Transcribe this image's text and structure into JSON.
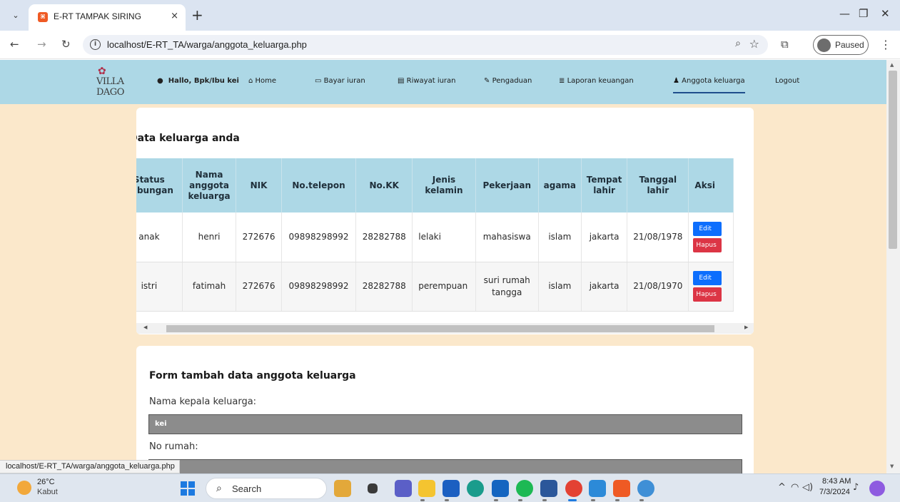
{
  "browser": {
    "tab_title": "E-RT TAMPAK SIRING",
    "tab_close": "×",
    "new_tab": "+",
    "url": "localhost/E-RT_TA/warga/anggota_keluarga.php",
    "profile_status": "Paused",
    "status_url": "localhost/E-RT_TA/warga/anggota_keluarga.php"
  },
  "site": {
    "logo_text": "VILLA DAGO",
    "greeting": "Hallo, Bpk/Ibu kei",
    "nav": [
      {
        "icon": "home-icon",
        "label": "Home"
      },
      {
        "icon": "card-icon",
        "label": "Bayar iuran"
      },
      {
        "icon": "history-icon",
        "label": "Riwayat iuran"
      },
      {
        "icon": "pen-icon",
        "label": "Pengaduan"
      },
      {
        "icon": "database-icon",
        "label": "Laporan keuangan"
      },
      {
        "icon": "users-icon",
        "label": "Anggota keluarga"
      },
      {
        "icon": "",
        "label": "Logout"
      }
    ],
    "active_nav": "Anggota keluarga",
    "accent_color": "#add8e6",
    "page_bg": "#fbe8cb"
  },
  "family_table": {
    "title": "Data keluarga anda",
    "headers": [
      "Status hubungan",
      "Nama anggota keluarga",
      "NIK",
      "No.telepon",
      "No.KK",
      "Jenis kelamin",
      "Pekerjaan",
      "agama",
      "Tempat lahir",
      "Tanggal lahir",
      "Aksi"
    ],
    "rows": [
      {
        "status": "anak",
        "nama": "henri",
        "nik": "272676",
        "telepon": "09898298992",
        "kk": "28282788",
        "jk": "lelaki",
        "pekerjaan": "mahasiswa",
        "agama": "islam",
        "tempat": "jakarta",
        "tanggal": "21/08/1978",
        "edit": "Edit",
        "hapus": "Hapus"
      },
      {
        "status": "istri",
        "nama": "fatimah",
        "nik": "272676",
        "telepon": "09898298992",
        "kk": "28282788",
        "jk": "perempuan",
        "pekerjaan": "suri rumah tangga",
        "agama": "islam",
        "tempat": "jakarta",
        "tanggal": "21/08/1970",
        "edit": "Edit",
        "hapus": "Hapus"
      }
    ]
  },
  "form": {
    "title": "Form tambah data anggota keluarga",
    "kepala_label": "Nama kepala keluarga:",
    "kepala_value": "kei",
    "rumah_label": "No rumah:",
    "rumah_value": ""
  },
  "taskbar": {
    "temperature": "26°C",
    "weather": "Kabut",
    "search_placeholder": "Search",
    "time": "8:43 AM",
    "date": "7/3/2024"
  }
}
